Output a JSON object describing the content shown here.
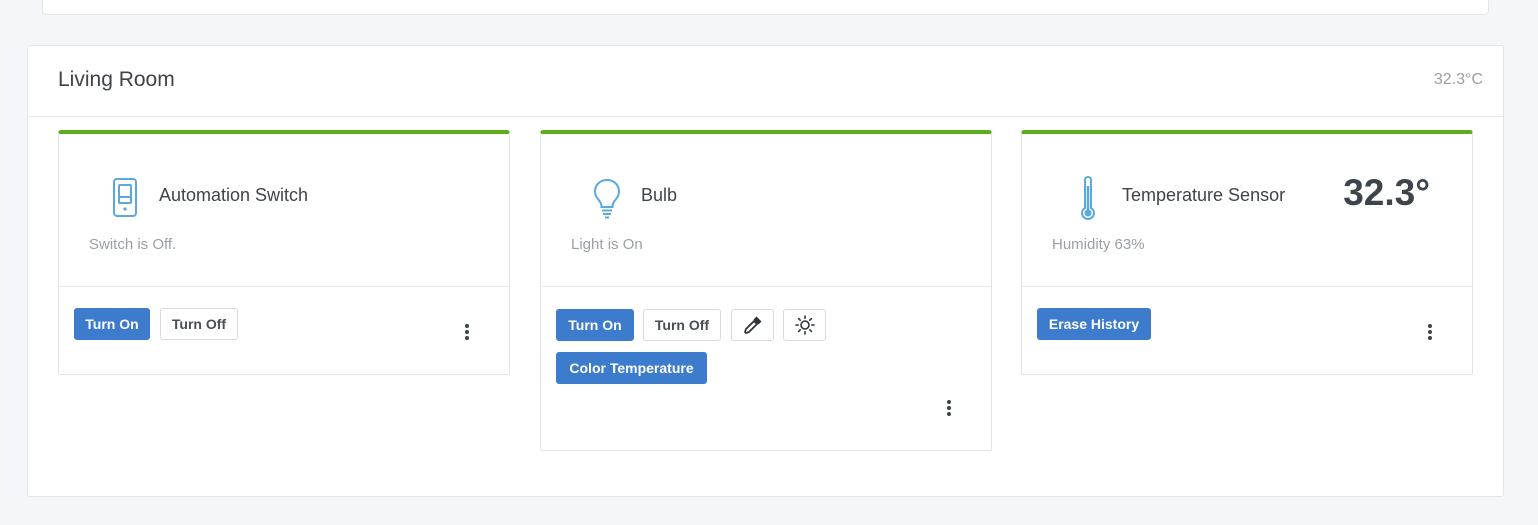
{
  "room": {
    "title": "Living Room",
    "temperature": "32.3°C"
  },
  "devices": [
    {
      "name": "Automation Switch",
      "status": "Switch is Off.",
      "icon": "switch-icon",
      "buttons": {
        "on": "Turn On",
        "off": "Turn Off"
      }
    },
    {
      "name": "Bulb",
      "status": "Light is On",
      "icon": "bulb-icon",
      "buttons": {
        "on": "Turn On",
        "off": "Turn Off",
        "color_temp": "Color Temperature"
      }
    },
    {
      "name": "Temperature Sensor",
      "status": "Humidity 63%",
      "icon": "thermometer-icon",
      "reading": "32.3°",
      "buttons": {
        "erase": "Erase History"
      }
    }
  ],
  "colors": {
    "accent": "#3d7ccc",
    "online_bar": "#5aae19",
    "icon": "#5aa9dd"
  }
}
